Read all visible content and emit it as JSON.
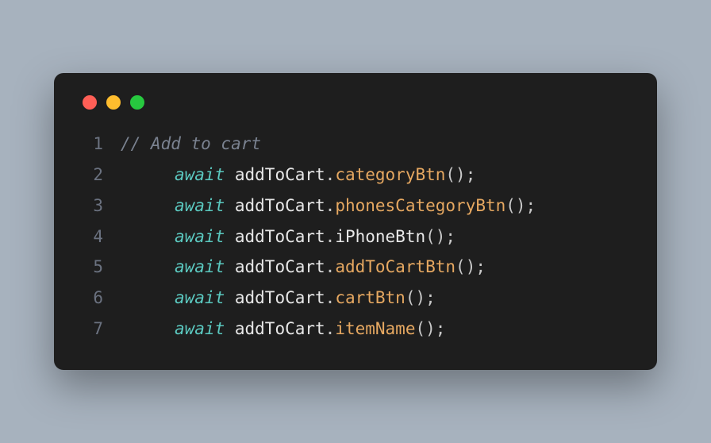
{
  "window": {
    "traffic_lights": [
      "red",
      "yellow",
      "green"
    ]
  },
  "code": {
    "lines": [
      {
        "num": "1",
        "type": "comment",
        "text": "// Add to cart"
      },
      {
        "num": "2",
        "type": "call",
        "keyword": "await",
        "object": "addToCart",
        "method": "categoryBtn",
        "accent": true
      },
      {
        "num": "3",
        "type": "call",
        "keyword": "await",
        "object": "addToCart",
        "method": "phonesCategoryBtn",
        "accent": true
      },
      {
        "num": "4",
        "type": "call",
        "keyword": "await",
        "object": "addToCart",
        "method": "iPhoneBtn",
        "accent": false
      },
      {
        "num": "5",
        "type": "call",
        "keyword": "await",
        "object": "addToCart",
        "method": "addToCartBtn",
        "accent": true
      },
      {
        "num": "6",
        "type": "call",
        "keyword": "await",
        "object": "addToCart",
        "method": "cartBtn",
        "accent": true
      },
      {
        "num": "7",
        "type": "call",
        "keyword": "await",
        "object": "addToCart",
        "method": "itemName",
        "accent": true
      }
    ]
  }
}
